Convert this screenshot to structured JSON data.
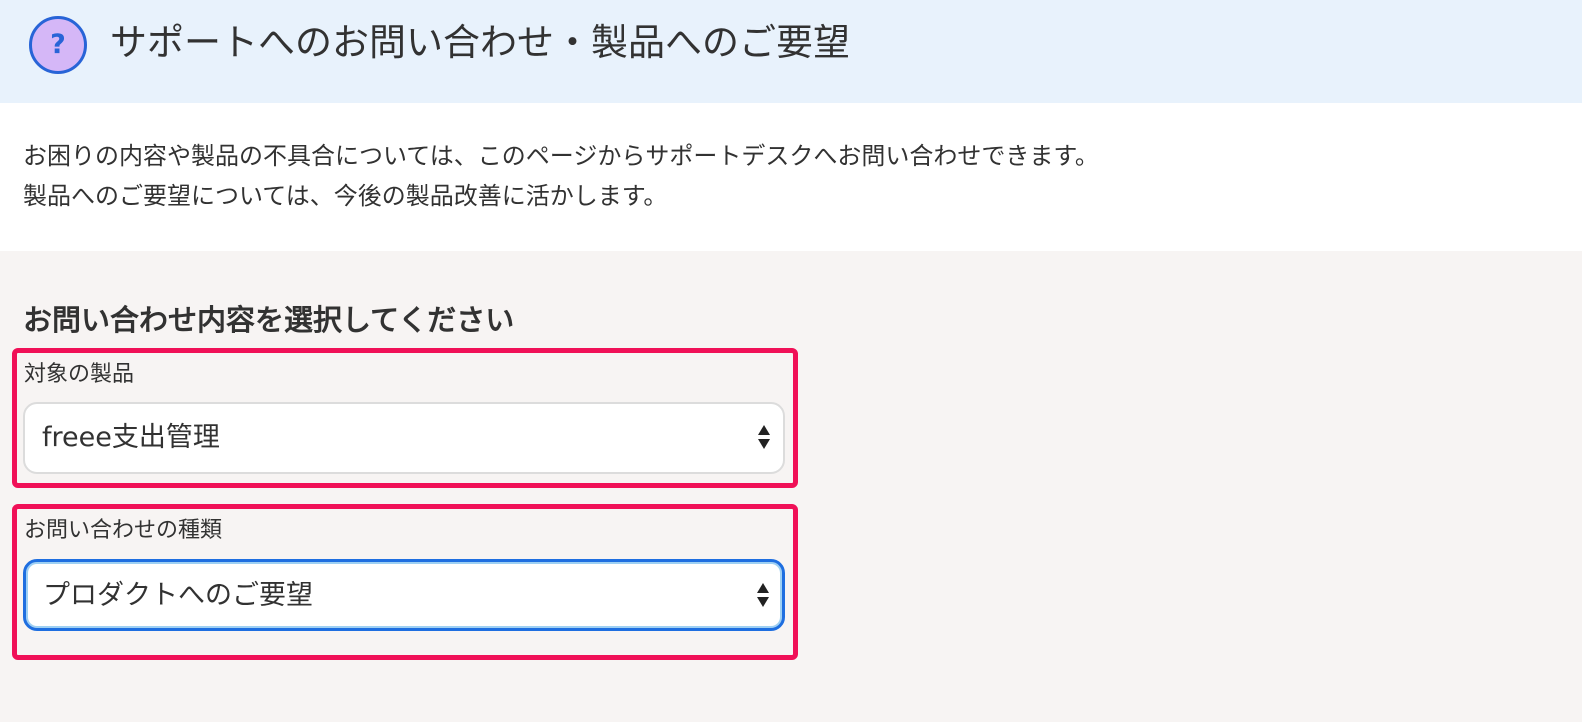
{
  "header": {
    "icon": "help-icon",
    "icon_glyph": "?",
    "title": "サポートへのお問い合わせ・製品へのご要望"
  },
  "intro": {
    "line1": "お困りの内容や製品の不具合については、このページからサポートデスクへお問い合わせできます。",
    "line2": "製品へのご要望については、今後の製品改善に活かします。"
  },
  "form": {
    "heading": "お問い合わせ内容を選択してください",
    "product": {
      "label": "対象の製品",
      "selected": "freee支出管理"
    },
    "type": {
      "label": "お問い合わせの種類",
      "selected": "プロダクトへのご要望"
    }
  },
  "colors": {
    "header_bg": "#e8f2fc",
    "icon_fill": "#d5b7f7",
    "icon_ring": "#2864d7",
    "highlight_border": "#f01057",
    "focus_border": "#1e6ee0",
    "form_bg": "#f7f4f3"
  }
}
